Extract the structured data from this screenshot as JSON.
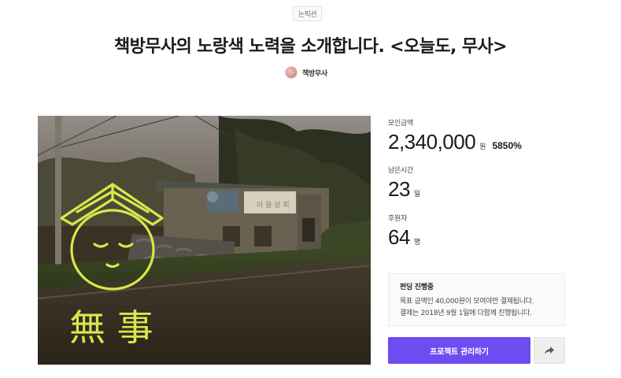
{
  "header": {
    "category": "논픽션",
    "title": "책방무사의 노랑색 노력을 소개합니다. <오늘도, 무사>",
    "creator_name": "책방무사"
  },
  "hero": {
    "logo_text": "無 事",
    "sign_text": "아 음 상 회",
    "logo_color": "#d8e84a"
  },
  "stats": {
    "raised_label": "모인금액",
    "raised_value": "2,340,000",
    "raised_unit": "원",
    "raised_percent": "5850%",
    "time_label": "남은시간",
    "time_value": "23",
    "time_unit": "일",
    "backers_label": "후원자",
    "backers_value": "64",
    "backers_unit": "명"
  },
  "funding_info": {
    "title": "펀딩 진행중",
    "line1": "목표 금액인 40,000원이 모여야만 결제됩니다.",
    "line2": "결제는 2018년 9월 1일에 다함께 진행됩니다."
  },
  "actions": {
    "manage_label": "프로젝트 관리하기",
    "share_icon": "share-icon",
    "accent_color": "#6e4cf2"
  }
}
